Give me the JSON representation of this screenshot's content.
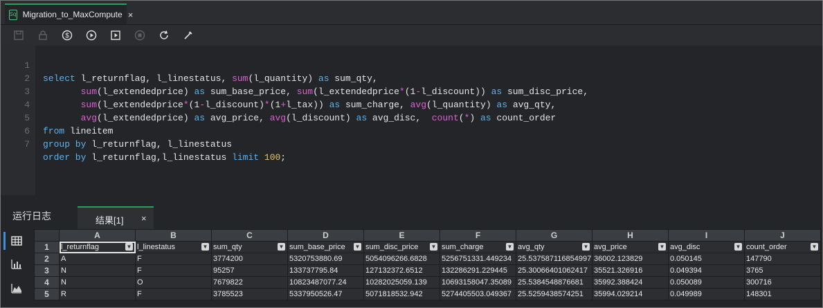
{
  "tab": {
    "icon_text": "Sq",
    "title": "Migration_to_MaxCompute",
    "close": "×"
  },
  "toolbar": {
    "icons": [
      "save-icon",
      "lock-icon",
      "cost-icon",
      "run-icon",
      "run-selected-icon",
      "stop-icon",
      "refresh-icon",
      "format-icon"
    ]
  },
  "editor": {
    "line_numbers": [
      "1",
      "2",
      "3",
      "4",
      "5",
      "6",
      "7"
    ]
  },
  "bottom_tabs": {
    "log_label": "运行日志",
    "result_label": "结果[1]",
    "result_close": "×"
  },
  "grid": {
    "column_letters": [
      "A",
      "B",
      "C",
      "D",
      "E",
      "F",
      "G",
      "H",
      "I",
      "J"
    ],
    "row_numbers": [
      "1",
      "2",
      "3",
      "4",
      "5"
    ],
    "headers": [
      "l_returnflag",
      "l_linestatus",
      "sum_qty",
      "sum_base_price",
      "sum_disc_price",
      "sum_charge",
      "avg_qty",
      "avg_price",
      "avg_disc",
      "count_order"
    ],
    "rows": [
      [
        "A",
        "F",
        "3774200",
        "5320753880.69",
        "5054096266.6828",
        "5256751331.449234",
        "25.537587116854997",
        "36002.123829",
        "0.050145",
        "147790"
      ],
      [
        "N",
        "F",
        "95257",
        "133737795.84",
        "127132372.6512",
        "132286291.229445",
        "25.30066401062417",
        "35521.326916",
        "0.049394",
        "3765"
      ],
      [
        "N",
        "O",
        "7679822",
        "10823487077.24",
        "10282025059.139",
        "10693158047.35089",
        "25.5384548876681",
        "35992.388424",
        "0.050089",
        "300716"
      ],
      [
        "R",
        "F",
        "3785523",
        "5337950526.47",
        "5071818532.942",
        "5274405503.049367",
        "25.5259438574251",
        "35994.029214",
        "0.049989",
        "148301"
      ]
    ]
  }
}
